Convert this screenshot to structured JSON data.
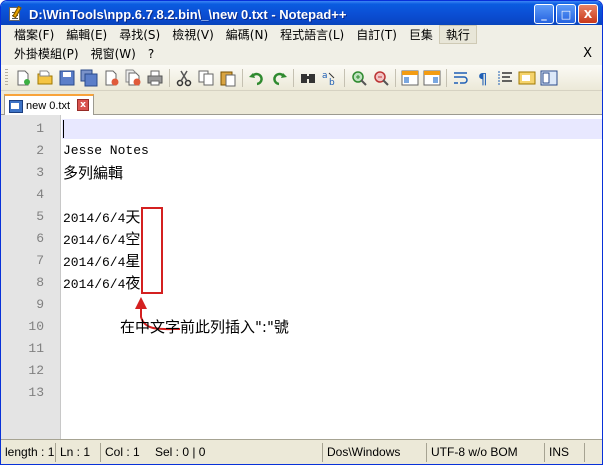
{
  "window": {
    "title": "D:\\WinTools\\npp.6.7.8.2.bin\\_\\new  0.txt - Notepad++",
    "minimize_glyph": "_",
    "maximize_glyph": "□",
    "close_glyph": "X"
  },
  "menu": {
    "row1": [
      "檔案(F)",
      "編輯(E)",
      "尋找(S)",
      "檢視(V)",
      "編碼(N)",
      "程式語言(L)",
      "自訂(T)",
      "巨集",
      "執行"
    ],
    "row2": [
      "外掛模組(P)",
      "視窗(W)",
      "?"
    ],
    "close_glyph": "X"
  },
  "toolbar": {
    "icons": [
      "new-file-icon",
      "open-file-icon",
      "save-icon",
      "save-all-icon",
      "close-file-icon",
      "close-all-icon",
      "print-icon",
      "cut-icon",
      "copy-icon",
      "paste-icon",
      "undo-icon",
      "redo-icon",
      "find-icon",
      "replace-icon",
      "zoom-in-icon",
      "zoom-out-icon",
      "sync-vertical-icon",
      "sync-horizontal-icon",
      "word-wrap-icon",
      "show-all-chars-icon",
      "indent-guide-icon",
      "user-lang-icon",
      "doc-map-icon"
    ]
  },
  "tab": {
    "label": "new  0.txt",
    "close_glyph": "x"
  },
  "editor": {
    "line_numbers": [
      "1",
      "2",
      "3",
      "4",
      "5",
      "6",
      "7",
      "8",
      "9",
      "10",
      "11",
      "12",
      "13"
    ],
    "lines": [
      {
        "prefix": "",
        "cjk": ""
      },
      {
        "prefix": "Jesse Notes",
        "cjk": ""
      },
      {
        "prefix": "",
        "cjk": "多列編輯"
      },
      {
        "prefix": "",
        "cjk": ""
      },
      {
        "prefix": "2014/6/4",
        "cjk": "天"
      },
      {
        "prefix": "2014/6/4",
        "cjk": "空"
      },
      {
        "prefix": "2014/6/4",
        "cjk": "星"
      },
      {
        "prefix": "2014/6/4",
        "cjk": "夜"
      },
      {
        "prefix": "",
        "cjk": ""
      },
      {
        "prefix": "",
        "cjk": ""
      },
      {
        "prefix": "",
        "cjk": ""
      },
      {
        "prefix": "",
        "cjk": ""
      },
      {
        "prefix": "",
        "cjk": ""
      }
    ],
    "annotation": "在中文字前此列插入\":\"號",
    "annotation_color": "#d42020"
  },
  "status": {
    "length": "length : 1",
    "ln": "Ln : 1",
    "col": "Col : 1",
    "sel": "Sel : 0 | 0",
    "eol": "Dos\\Windows",
    "encoding": "UTF-8 w/o BOM",
    "mode": "INS"
  }
}
